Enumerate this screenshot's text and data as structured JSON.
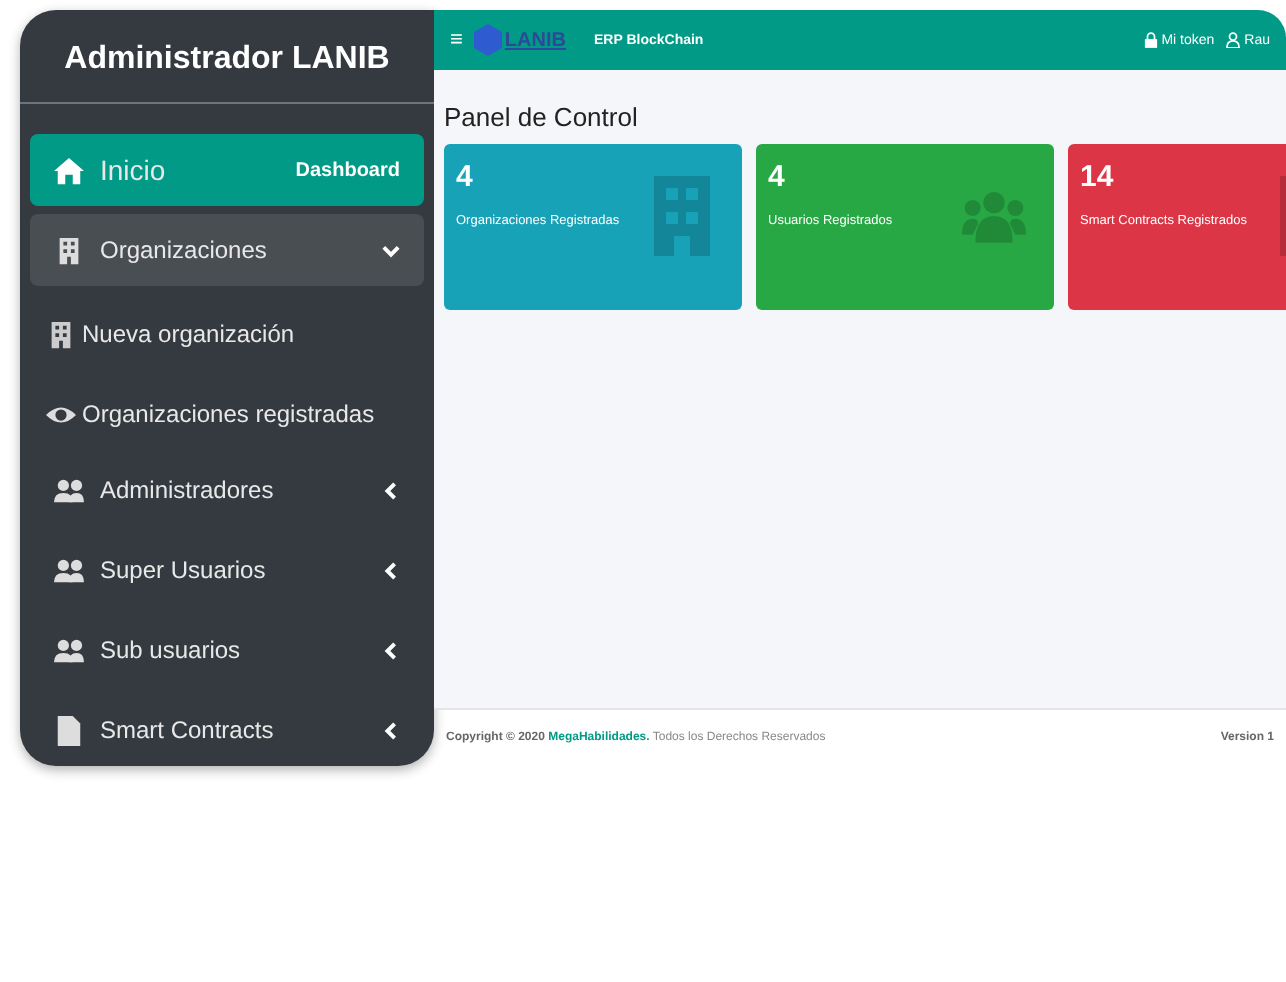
{
  "sidebar": {
    "title": "Administrador LANIB",
    "items": [
      {
        "label": "Inicio",
        "badge": "Dashboard",
        "selected": true,
        "expanded": false
      },
      {
        "label": "Organizaciones",
        "selected": false,
        "expanded": true,
        "children": [
          {
            "label": "Nueva organización"
          },
          {
            "label": "Organizaciones registradas"
          }
        ]
      },
      {
        "label": "Administradores",
        "selected": false,
        "expanded": false
      },
      {
        "label": "Super Usuarios",
        "selected": false,
        "expanded": false
      },
      {
        "label": "Sub usuarios",
        "selected": false,
        "expanded": false
      },
      {
        "label": "Smart Contracts",
        "selected": false,
        "expanded": false
      }
    ]
  },
  "header": {
    "menu_icon": "≡",
    "logo_text": "LANIB",
    "app_name": "ERP BlockChain",
    "links": [
      "Mi token",
      "Rau"
    ]
  },
  "page_title": "Panel de Control",
  "cards": [
    {
      "value": "4",
      "label": "Organizaciones Registradas",
      "color": "#17a2b8"
    },
    {
      "value": "4",
      "label": "Usuarios Registrados",
      "color": "#28a745"
    },
    {
      "value": "14",
      "label": "Smart Contracts Registrados",
      "color": "#dc3545"
    }
  ],
  "footer": {
    "copyright": "Copyright © 2020",
    "link": "MegaHabilidades.",
    "rights": "Todos los Derechos Reservados",
    "version": "Version 1"
  }
}
